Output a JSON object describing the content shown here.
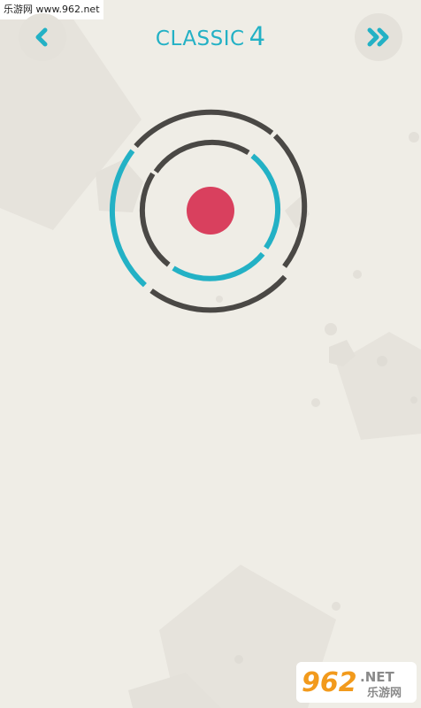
{
  "watermark": {
    "text": "乐游网 www.962.net"
  },
  "header": {
    "mode": "CLASSIC",
    "level": "4"
  },
  "logo": {
    "brand": "962",
    "suffix": ".NET",
    "chinese": "乐游网"
  },
  "colors": {
    "background": "#efede6",
    "accent": "#23b1c5",
    "ring_dark": "#4a4845",
    "ball": "#d9405e",
    "button": "#e4e1da",
    "logo_orange": "#f29a1c"
  },
  "icons": {
    "back": "chevron-left-icon",
    "next": "double-chevron-right-icon"
  }
}
